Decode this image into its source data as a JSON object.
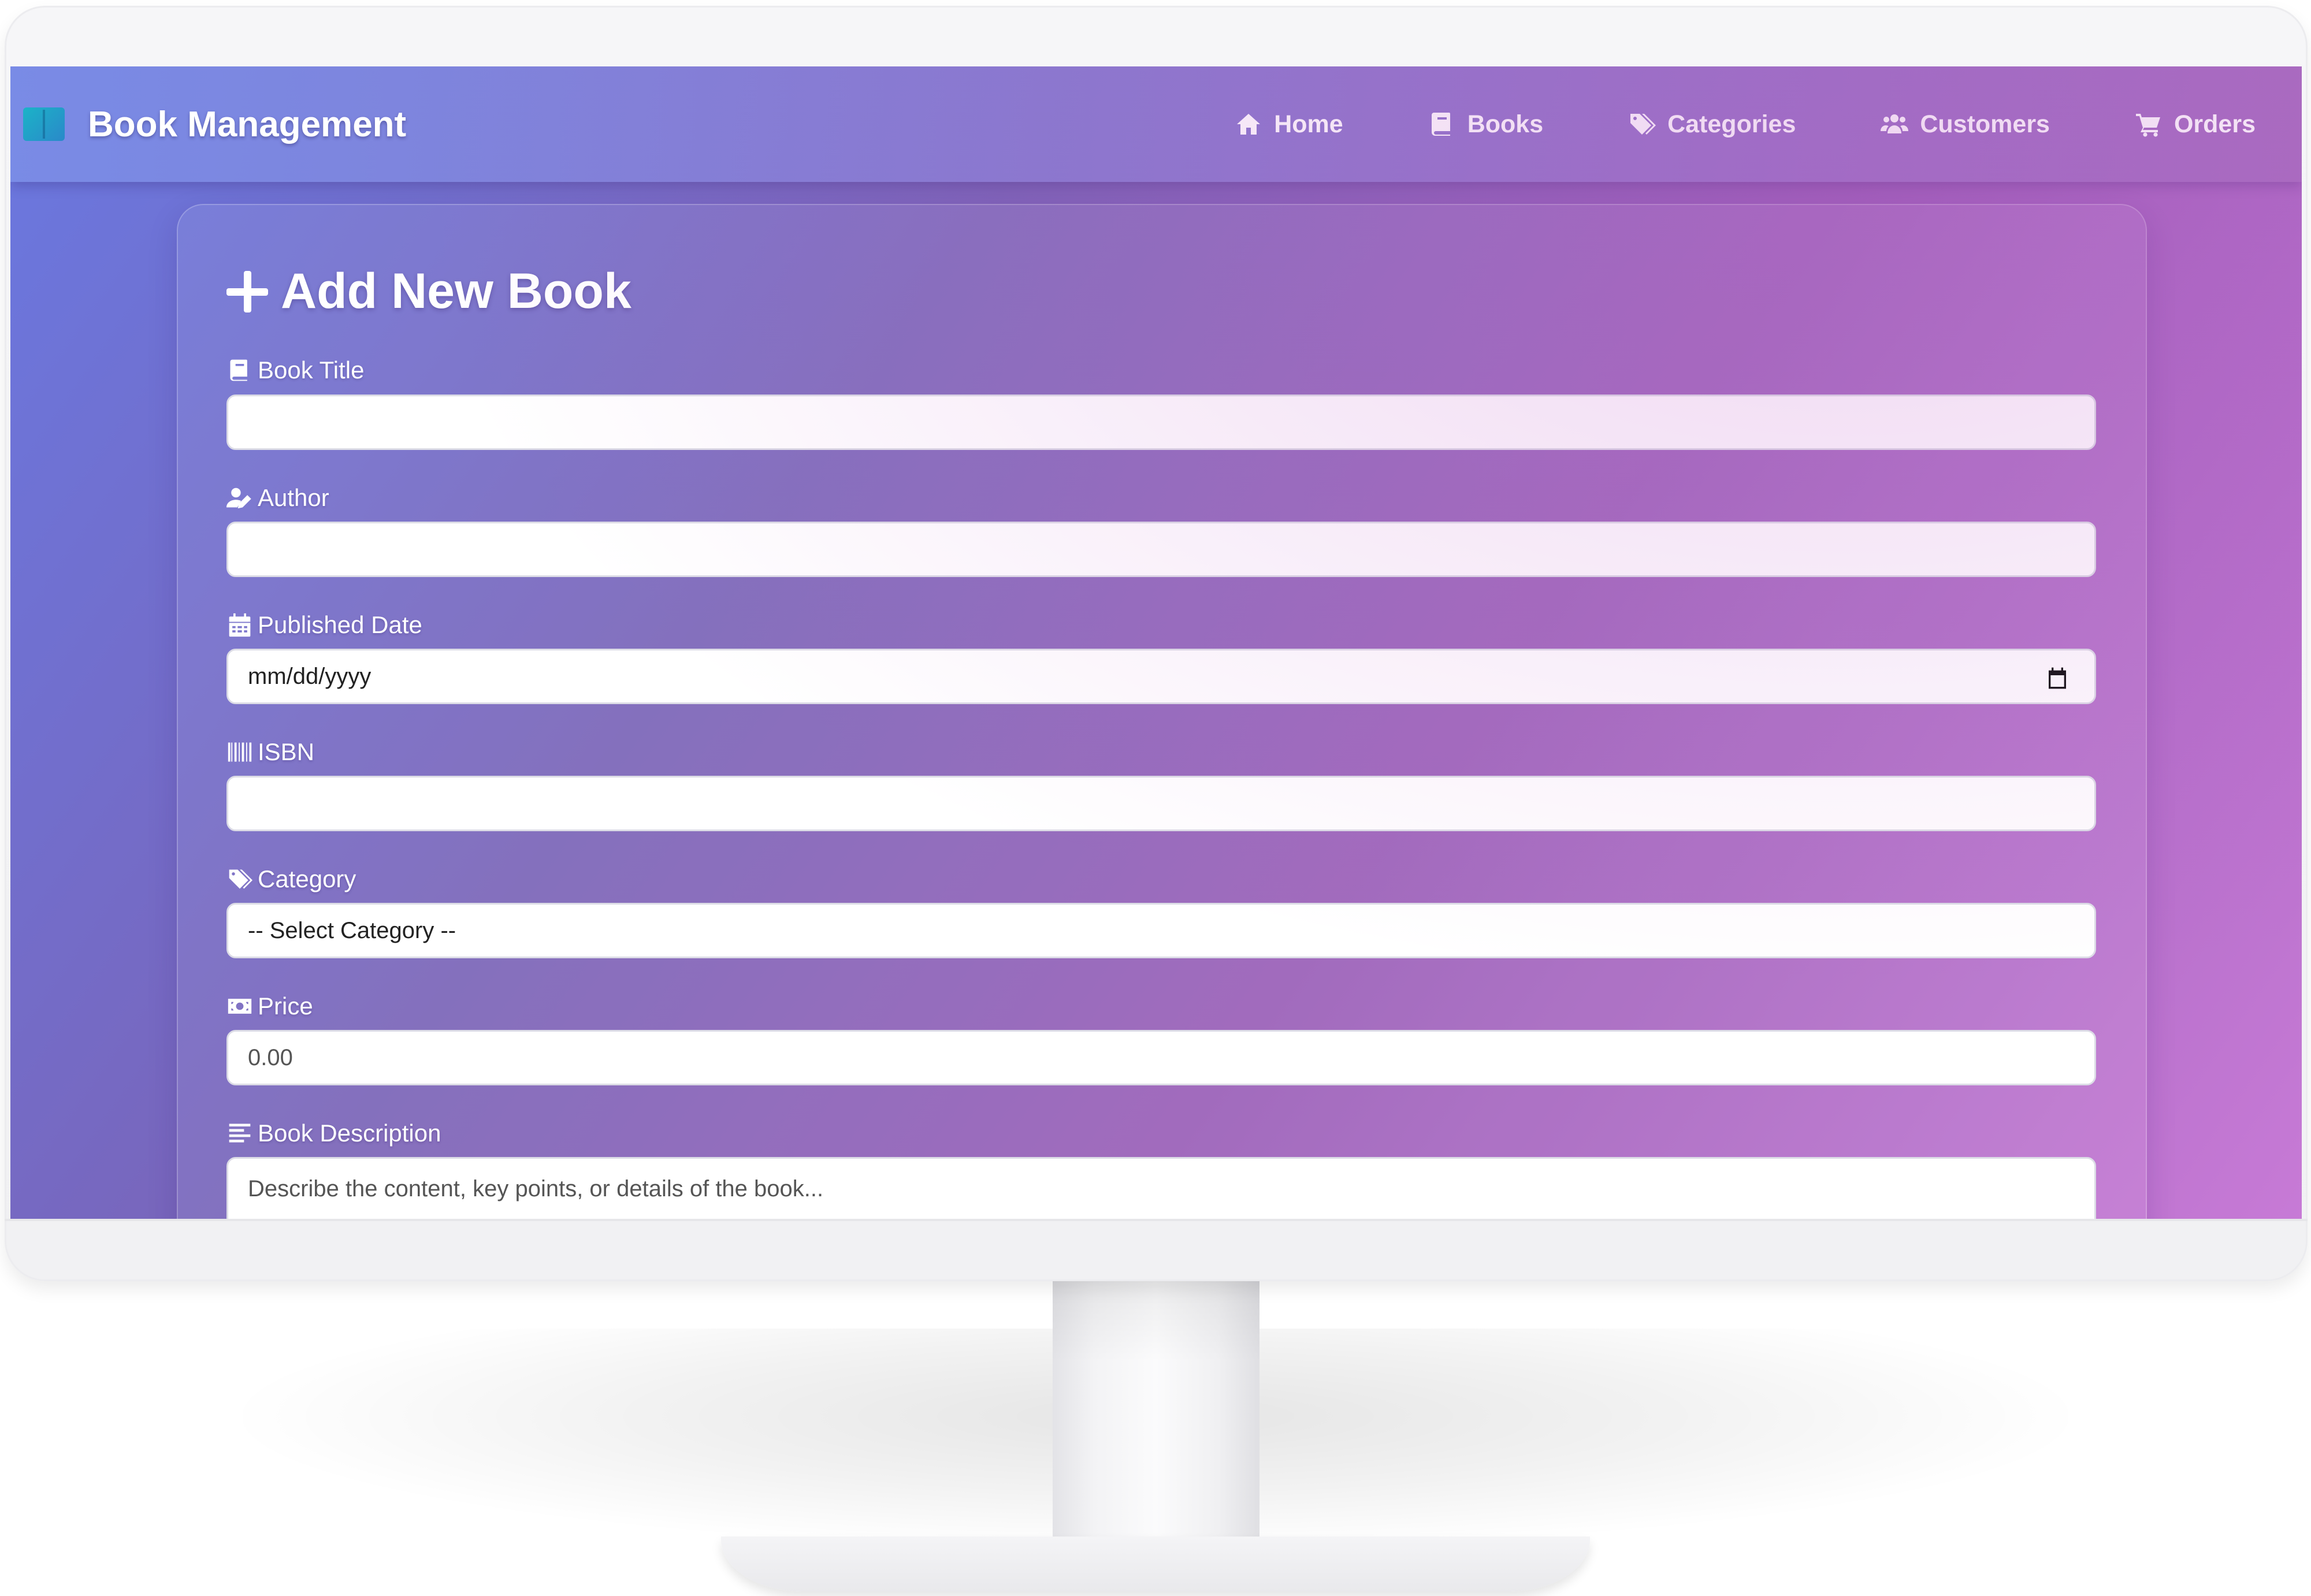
{
  "app": {
    "brand": "Book Management"
  },
  "nav": {
    "items": [
      {
        "label": "Home",
        "icon": "home-icon"
      },
      {
        "label": "Books",
        "icon": "book-icon"
      },
      {
        "label": "Categories",
        "icon": "tags-icon"
      },
      {
        "label": "Customers",
        "icon": "users-icon"
      },
      {
        "label": "Orders",
        "icon": "cart-icon"
      }
    ]
  },
  "form": {
    "title": "Add New Book",
    "fields": {
      "title": {
        "label": "Book Title",
        "icon": "book-icon",
        "value": ""
      },
      "author": {
        "label": "Author",
        "icon": "user-pen-icon",
        "value": ""
      },
      "published": {
        "label": "Published Date",
        "icon": "calendar-icon",
        "placeholder": "mm/dd/yyyy"
      },
      "isbn": {
        "label": "ISBN",
        "icon": "barcode-icon",
        "value": ""
      },
      "category": {
        "label": "Category",
        "icon": "tags-icon",
        "selected": "-- Select Category --"
      },
      "price": {
        "label": "Price",
        "icon": "money-bill-icon",
        "placeholder": "0.00"
      },
      "description": {
        "label": "Book Description",
        "icon": "align-left-icon",
        "placeholder": "Describe the content, key points, or details of the book..."
      }
    }
  },
  "colors": {
    "gradient_start": "#6a78e0",
    "gradient_mid": "#9a5fb8",
    "gradient_end": "#c77ad6",
    "logo": "#1bb3c8"
  }
}
